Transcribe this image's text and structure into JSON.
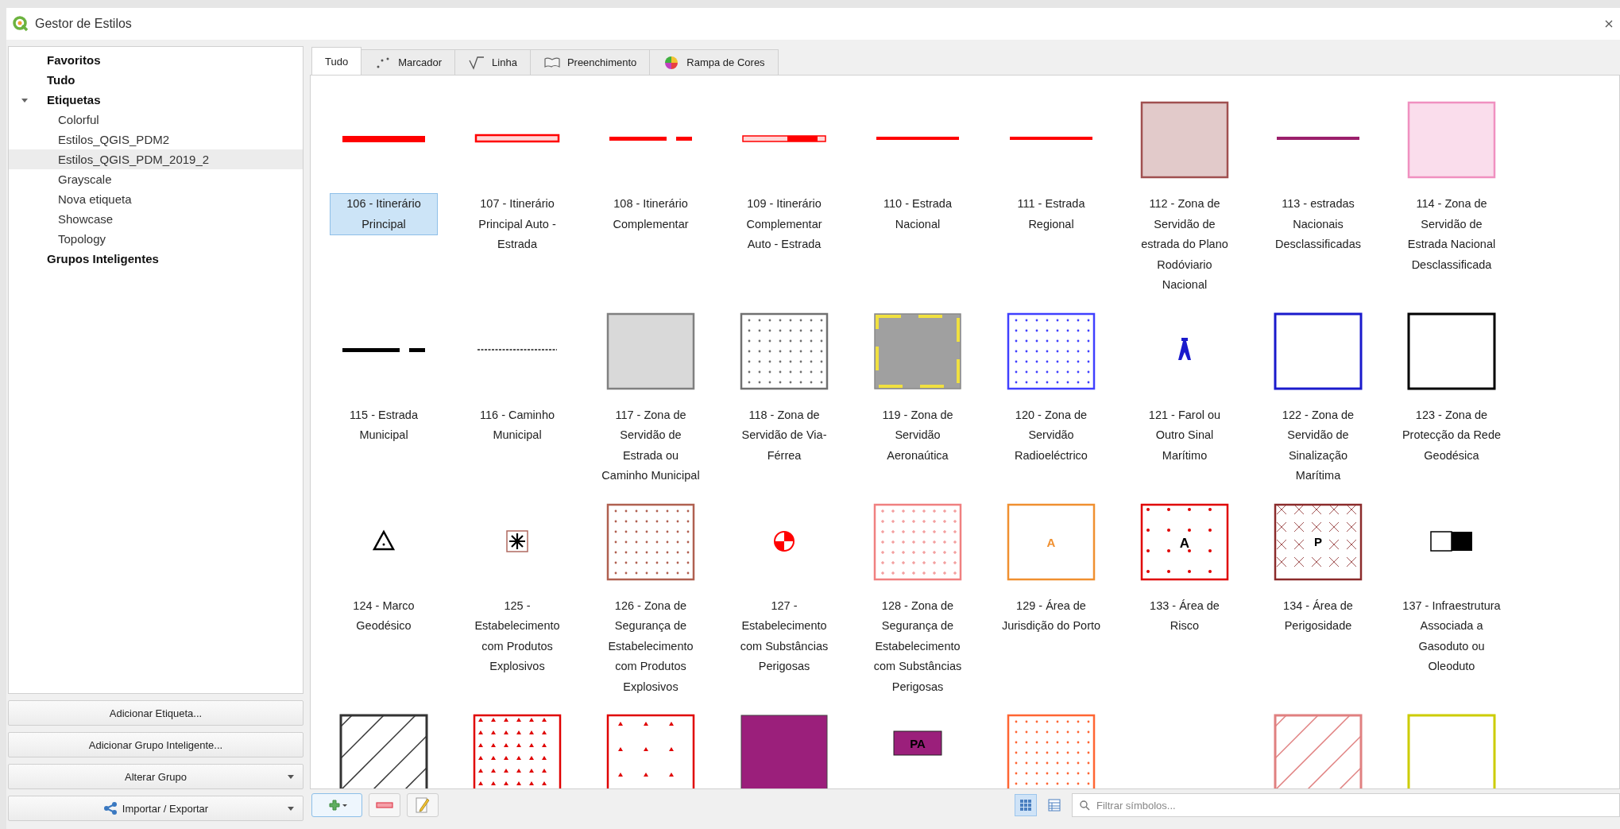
{
  "window": {
    "title": "Gestor de Estilos"
  },
  "tree": [
    {
      "label": "Favoritos",
      "selected": false
    },
    {
      "label": "Tudo",
      "selected": false
    },
    {
      "label": "Etiquetas",
      "selected": false,
      "expanded": true,
      "children": [
        {
          "label": "Colorful",
          "selected": false
        },
        {
          "label": "Estilos_QGIS_PDM2",
          "selected": false
        },
        {
          "label": "Estilos_QGIS_PDM_2019_2",
          "selected": true
        },
        {
          "label": "Grayscale",
          "selected": false
        },
        {
          "label": "Nova etiqueta",
          "selected": false
        },
        {
          "label": "Showcase",
          "selected": false
        },
        {
          "label": "Topology",
          "selected": false
        }
      ]
    },
    {
      "label": "Grupos Inteligentes",
      "selected": false
    }
  ],
  "left_buttons": [
    {
      "label": "Adicionar Etiqueta...",
      "kind": "plain"
    },
    {
      "label": "Adicionar Grupo Inteligente...",
      "kind": "plain"
    },
    {
      "label": "Alterar Grupo",
      "kind": "dropdown"
    },
    {
      "label": "Importar / Exportar",
      "kind": "share-dropdown"
    }
  ],
  "tabs": [
    {
      "label": "Tudo",
      "kind": "all",
      "selected": true
    },
    {
      "label": "Marcador",
      "kind": "marker",
      "selected": false
    },
    {
      "label": "Linha",
      "kind": "line",
      "selected": false
    },
    {
      "label": "Preenchimento",
      "kind": "fill",
      "selected": false
    },
    {
      "label": "Rampa de Cores",
      "kind": "ramp",
      "selected": false
    }
  ],
  "symbols": [
    {
      "label": "106 - Itinerário Principal",
      "kind": "line-thick",
      "color": "#ff0000",
      "selected": true
    },
    {
      "label": "107 - Itinerário Principal Auto - Estrada",
      "kind": "line-casing",
      "color": "#ff0000",
      "selected": false
    },
    {
      "label": "108 - Itinerário Complementar",
      "kind": "line-dash",
      "color": "#ff0000",
      "selected": false
    },
    {
      "label": "109 - Itinerário Complementar Auto - Estrada",
      "kind": "line-casing-dash",
      "color": "#ff0000",
      "selected": false
    },
    {
      "label": "110 - Estrada Nacional",
      "kind": "line-thin",
      "color": "#ff0000",
      "selected": false
    },
    {
      "label": "111 - Estrada Regional",
      "kind": "line-thin",
      "color": "#ff0000",
      "selected": false
    },
    {
      "label": "112 - Zona de Servidão de estrada do Plano Rodóviario Nacional",
      "kind": "fill-texture",
      "color": "#a05050",
      "selected": false
    },
    {
      "label": "113 - estradas Nacionais Desclassificadas",
      "kind": "line-thin",
      "color": "#9b1f6b",
      "selected": false
    },
    {
      "label": "114 - Zona de Servidão de Estrada Nacional Desclassificada",
      "kind": "fill-texture",
      "color": "#f090c0",
      "selected": false
    },
    {
      "label": "115 - Estrada Municipal",
      "kind": "line-dash",
      "color": "#000000",
      "selected": false
    },
    {
      "label": "116 - Caminho Municipal",
      "kind": "line-dotted",
      "color": "#555555",
      "selected": false
    },
    {
      "label": "117 - Zona de Servidão de Estrada ou Caminho Municipal",
      "kind": "fill-texture",
      "color": "#808080",
      "selected": false
    },
    {
      "label": "118 - Zona de Servidão de Via-Férrea",
      "kind": "fill-dots",
      "color": "#707070",
      "selected": false
    },
    {
      "label": "119 - Zona de Servidão Aeronaútica",
      "kind": "fill-dashborder",
      "color": "#a0a0a0",
      "selected": false
    },
    {
      "label": "120 - Zona de Servidão Radioeléctrico",
      "kind": "fill-dots",
      "color": "#4040ff",
      "selected": false
    },
    {
      "label": "121 - Farol ou Outro Sinal Marítimo",
      "kind": "marker-beacon",
      "color": "#1a1acc",
      "selected": false
    },
    {
      "label": "122 - Zona de Servidão de Sinalização Marítima",
      "kind": "outline",
      "color": "#1a1acc",
      "selected": false
    },
    {
      "label": "123 - Zona de Protecção da Rede Geodésica",
      "kind": "outline",
      "color": "#000000",
      "selected": false
    },
    {
      "label": "124 - Marco Geodésico",
      "kind": "marker-triangle",
      "color": "#000000",
      "selected": false
    },
    {
      "label": "125 - Estabelecimento com Produtos Explosivos",
      "kind": "marker-star",
      "color": "#000000",
      "selected": false
    },
    {
      "label": "126 - Zona de Segurança de Estabelecimento com Produtos Explosivos",
      "kind": "fill-dots",
      "color": "#b06050",
      "selected": false
    },
    {
      "label": "127 - Estabelecimento com Substâncias Perigosas",
      "kind": "marker-quarters",
      "color": "#ff0000",
      "selected": false
    },
    {
      "label": "128 - Zona de Segurança de Estabelecimento com Substâncias Perigosas",
      "kind": "fill-plus",
      "color": "#f08080",
      "selected": false
    },
    {
      "label": "129 - Área de Jurisdição do Porto",
      "kind": "outline-glyph",
      "color": "#f09030",
      "glyph": "A",
      "selected": false
    },
    {
      "label": "133 - Área de Risco",
      "kind": "fill-dots-glyph",
      "color": "#e00000",
      "glyph": "A",
      "selected": false
    },
    {
      "label": "134 - Área de Perigosidade",
      "kind": "fill-cross-glyph",
      "color": "#8b2b2b",
      "glyph": "P",
      "selected": false
    },
    {
      "label": "137 - Infraestrutura Associada a Gasoduto ou Oleoduto",
      "kind": "marker-halfbox",
      "color": "#000000",
      "selected": false
    },
    {
      "kind": "hatch",
      "color": "#333333",
      "selected": false
    },
    {
      "kind": "fill-triangles",
      "color": "#e00000",
      "selected": false
    },
    {
      "kind": "fill-triangles-sparse",
      "color": "#e00000",
      "selected": false
    },
    {
      "kind": "fill-solid",
      "color": "#9b1f7b",
      "selected": false
    },
    {
      "kind": "label-box",
      "color": "#9b1f7b",
      "glyph": "PA",
      "selected": false
    },
    {
      "kind": "fill-dots",
      "color": "#ff6633",
      "selected": false
    },
    {
      "kind": "blank"
    },
    {
      "kind": "hatch",
      "color": "#e08080",
      "selected": false
    },
    {
      "kind": "outline",
      "color": "#cccc00",
      "selected": false
    }
  ],
  "bottom_toolbar": {
    "view_modes": [
      {
        "kind": "icons",
        "selected": true
      },
      {
        "kind": "list",
        "selected": false
      }
    ],
    "search": {
      "placeholder": "Filtrar símbolos..."
    }
  }
}
